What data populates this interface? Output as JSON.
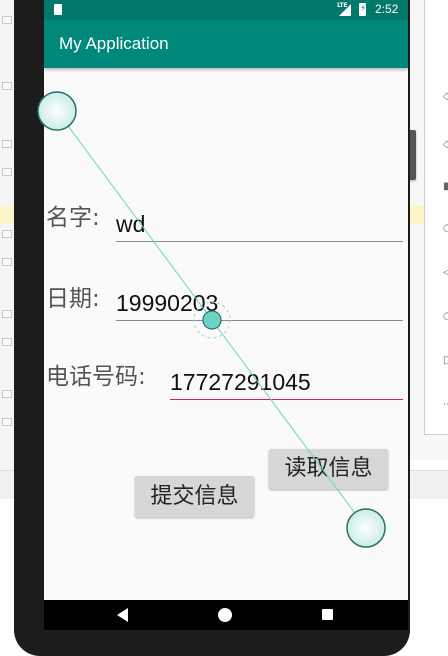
{
  "status_bar": {
    "network_label": "LTE",
    "time": "2:52",
    "battery_glyph": "⚡"
  },
  "app_bar": {
    "title": "My Application"
  },
  "form": {
    "name_label": "名字:",
    "name_value": "wd",
    "date_label": "日期:",
    "date_value": "19990203",
    "phone_label": "电话号码:",
    "phone_value": "17727291045"
  },
  "buttons": {
    "read_label": "读取信息",
    "submit_label": "提交信息"
  },
  "nav_bar": {
    "back_icon": "back-triangle",
    "home_icon": "home-circle",
    "recents_icon": "recents-square"
  },
  "colors": {
    "status_bar": "#00796b",
    "app_bar": "#00897b",
    "focus_underline": "#d81b60",
    "overlay_accent": "#6ad3c3"
  }
}
